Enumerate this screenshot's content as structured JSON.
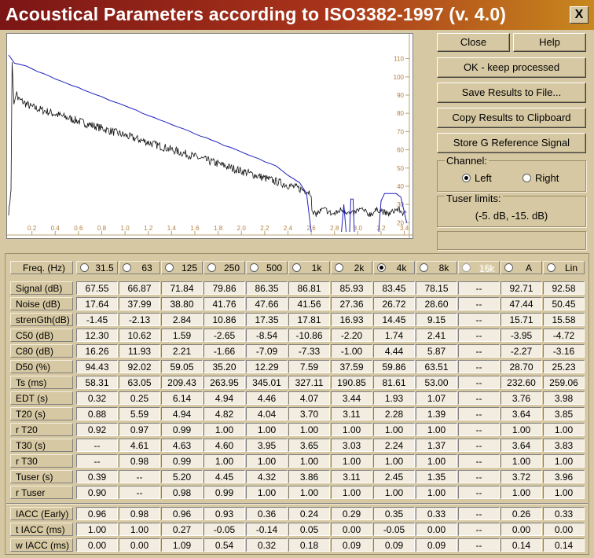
{
  "window": {
    "title": "Acoustical Parameters according to ISO3382-1997 (v. 4.0)",
    "close_glyph": "X"
  },
  "buttons": {
    "close": "Close",
    "help": "Help",
    "ok": "OK - keep processed",
    "save": "Save Results to File...",
    "copy": "Copy Results to Clipboard",
    "store": "Store G Reference Signal"
  },
  "channel": {
    "label": "Channel:",
    "left": "Left",
    "right": "Right",
    "selected": "left"
  },
  "tuser": {
    "label": "Tuser  limits:",
    "value": "(-5. dB, -15. dB)"
  },
  "plot": {
    "x_ticks": [
      "0.2",
      "0.4",
      "0.6",
      "0.8",
      "1.0",
      "1.2",
      "1.4",
      "1.6",
      "1.8",
      "2.0",
      "2.2",
      "2.4",
      "2.6",
      "2.8",
      "3.0",
      "3.2",
      "3.4"
    ],
    "y_ticks": [
      "110",
      "100",
      "90",
      "80",
      "70",
      "60",
      "50",
      "40",
      "30",
      "20"
    ],
    "line_colors": {
      "schroeder": "#2020c0",
      "decay": "#101010"
    }
  },
  "table": {
    "freq_label": "Freq. (Hz)",
    "frequencies": [
      "31.5",
      "63",
      "125",
      "250",
      "500",
      "1k",
      "2k",
      "4k",
      "8k",
      "16k",
      "A",
      "Lin"
    ],
    "selected_frequency": "4k",
    "disabled_frequency": "16k",
    "rows": [
      {
        "label": "Signal (dB)",
        "values": [
          "67.55",
          "66.87",
          "71.84",
          "79.86",
          "86.35",
          "86.81",
          "85.93",
          "83.45",
          "78.15",
          "--",
          "92.71",
          "92.58"
        ]
      },
      {
        "label": "Noise (dB)",
        "values": [
          "17.64",
          "37.99",
          "38.80",
          "41.76",
          "47.66",
          "41.56",
          "27.36",
          "26.72",
          "28.60",
          "--",
          "47.44",
          "50.45"
        ]
      },
      {
        "label": "strenGth(dB)",
        "values": [
          "-1.45",
          "-2.13",
          "2.84",
          "10.86",
          "17.35",
          "17.81",
          "16.93",
          "14.45",
          "9.15",
          "--",
          "15.71",
          "15.58"
        ]
      },
      {
        "label": "C50   (dB)",
        "values": [
          "12.30",
          "10.62",
          "1.59",
          "-2.65",
          "-8.54",
          "-10.86",
          "-2.20",
          "1.74",
          "2.41",
          "--",
          "-3.95",
          "-4.72"
        ]
      },
      {
        "label": "C80   (dB)",
        "values": [
          "16.26",
          "11.93",
          "2.21",
          "-1.66",
          "-7.09",
          "-7.33",
          "-1.00",
          "4.44",
          "5.87",
          "--",
          "-2.27",
          "-3.16"
        ]
      },
      {
        "label": "D50    (%)",
        "values": [
          "94.43",
          "92.02",
          "59.05",
          "35.20",
          "12.29",
          "7.59",
          "37.59",
          "59.86",
          "63.51",
          "--",
          "28.70",
          "25.23"
        ]
      },
      {
        "label": "Ts     (ms)",
        "values": [
          "58.31",
          "63.05",
          "209.43",
          "263.95",
          "345.01",
          "327.11",
          "190.85",
          "81.61",
          "53.00",
          "--",
          "232.60",
          "259.06"
        ]
      },
      {
        "label": "EDT    (s)",
        "values": [
          "0.32",
          "0.25",
          "6.14",
          "4.94",
          "4.46",
          "4.07",
          "3.44",
          "1.93",
          "1.07",
          "--",
          "3.76",
          "3.98"
        ]
      },
      {
        "label": "T20    (s)",
        "values": [
          "0.88",
          "5.59",
          "4.94",
          "4.82",
          "4.04",
          "3.70",
          "3.11",
          "2.28",
          "1.39",
          "--",
          "3.64",
          "3.85"
        ]
      },
      {
        "label": "r T20",
        "values": [
          "0.92",
          "0.97",
          "0.99",
          "1.00",
          "1.00",
          "1.00",
          "1.00",
          "1.00",
          "1.00",
          "--",
          "1.00",
          "1.00"
        ]
      },
      {
        "label": "T30    (s)",
        "values": [
          "--",
          "4.61",
          "4.63",
          "4.60",
          "3.95",
          "3.65",
          "3.03",
          "2.24",
          "1.37",
          "--",
          "3.64",
          "3.83"
        ]
      },
      {
        "label": "r T30",
        "values": [
          "--",
          "0.98",
          "0.99",
          "1.00",
          "1.00",
          "1.00",
          "1.00",
          "1.00",
          "1.00",
          "--",
          "1.00",
          "1.00"
        ]
      },
      {
        "label": "Tuser (s)",
        "values": [
          "0.39",
          "--",
          "5.20",
          "4.45",
          "4.32",
          "3.86",
          "3.11",
          "2.45",
          "1.35",
          "--",
          "3.72",
          "3.96"
        ]
      },
      {
        "label": "r Tuser",
        "values": [
          "0.90",
          "--",
          "0.98",
          "0.99",
          "1.00",
          "1.00",
          "1.00",
          "1.00",
          "1.00",
          "--",
          "1.00",
          "1.00"
        ]
      }
    ],
    "iacc_rows": [
      {
        "label": "IACC (Early)",
        "values": [
          "0.96",
          "0.98",
          "0.96",
          "0.93",
          "0.36",
          "0.24",
          "0.29",
          "0.35",
          "0.33",
          "--",
          "0.26",
          "0.33"
        ]
      },
      {
        "label": "t IACC (ms)",
        "values": [
          "1.00",
          "1.00",
          "0.27",
          "-0.05",
          "-0.14",
          "0.05",
          "0.00",
          "-0.05",
          "0.00",
          "--",
          "0.00",
          "0.00"
        ]
      },
      {
        "label": "w IACC (ms)",
        "values": [
          "0.00",
          "0.00",
          "1.09",
          "0.54",
          "0.32",
          "0.18",
          "0.09",
          "0.09",
          "0.09",
          "--",
          "0.14",
          "0.14"
        ]
      }
    ]
  }
}
